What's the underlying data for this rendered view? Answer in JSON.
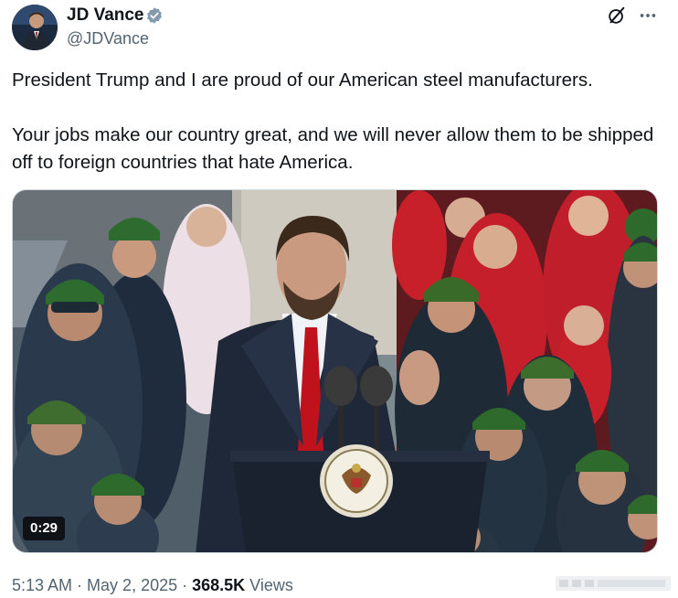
{
  "author": {
    "name": "JD Vance",
    "handle": "@JDVance",
    "verified_color": "#829aab"
  },
  "tweet": {
    "paragraph_1": "President Trump and I are proud of our American steel manufacturers.",
    "paragraph_2": "Your jobs make our country great, and we will never allow them to be shipped off to foreign countries that hate America."
  },
  "media": {
    "duration": "0:29",
    "podium_seal_text": "VICE PRESIDENT OF THE UNITED STATES"
  },
  "meta": {
    "time": "5:13 AM",
    "separator_1": " · ",
    "date": "May 2, 2025",
    "separator_2": " · ",
    "views_count": "368.5K",
    "views_label": " Views"
  },
  "icons": {
    "verified": "verified-badge-icon",
    "grok": "grok-icon",
    "more": "more-options-icon"
  }
}
